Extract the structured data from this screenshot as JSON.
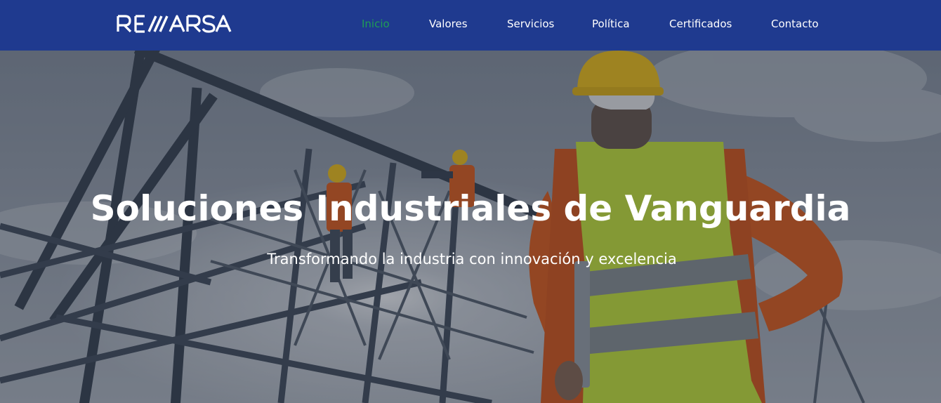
{
  "brand": {
    "name": "REMARSA"
  },
  "nav": {
    "items": [
      {
        "label": "Inicio",
        "active": true
      },
      {
        "label": "Valores",
        "active": false
      },
      {
        "label": "Servicios",
        "active": false
      },
      {
        "label": "Política",
        "active": false
      },
      {
        "label": "Certificados",
        "active": false
      },
      {
        "label": "Contacto",
        "active": false
      }
    ]
  },
  "hero": {
    "title": "Soluciones Industriales de Vanguardia",
    "subtitle": "Transformando la industria con innovación y excelencia"
  },
  "colors": {
    "navbar_bg": "#1f3a8f",
    "active_link": "#1f9d55",
    "text": "#ffffff",
    "vest": "#c8e63a",
    "helmet": "#f2c21b",
    "jacket": "#e0601e"
  }
}
